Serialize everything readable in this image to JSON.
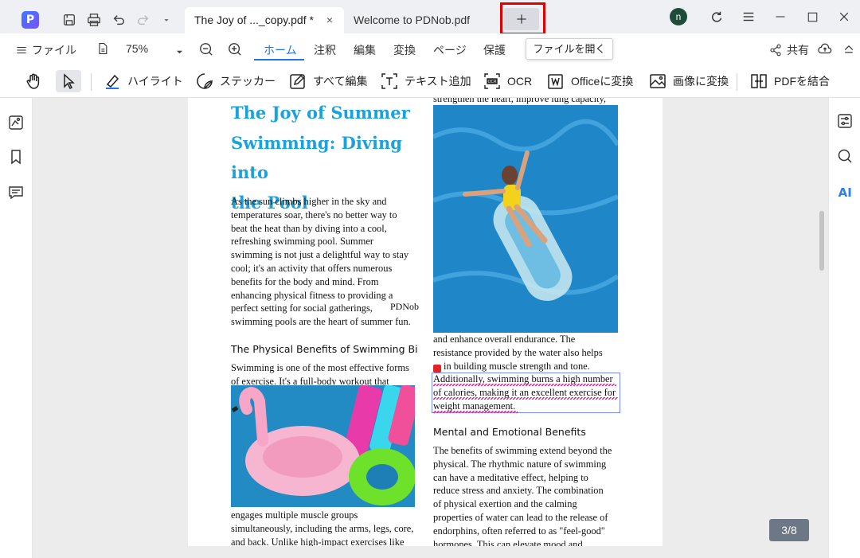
{
  "tabs": [
    {
      "label": "The Joy of ..._copy.pdf *",
      "close": "×",
      "active": true
    },
    {
      "label": "Welcome to PDNob.pdf",
      "active": false
    }
  ],
  "titlebar": {
    "avatar_letter": "n",
    "new_tab_symbol": "+"
  },
  "menu": {
    "file_label": "ファイル",
    "zoom_value": "75%",
    "tabs": [
      "ホーム",
      "注釈",
      "編集",
      "変換",
      "ページ",
      "保護"
    ],
    "share_label": "共有",
    "tooltip": "ファイルを開く"
  },
  "toolbar": {
    "highlight": "ハイライト",
    "sticker": "ステッカー",
    "edit_all": "すべて編集",
    "add_text": "テキスト追加",
    "ocr": "OCR",
    "to_office": "Officeに変換",
    "to_image": "画像に変換",
    "merge_pdf": "PDFを結合"
  },
  "document": {
    "title_lines": [
      "The Joy of Summer",
      "Swimming: Diving into",
      "the Pool"
    ],
    "intro_lines": [
      "As the sun climbs higher in the sky and",
      "temperatures soar, there's no better way to",
      "beat the heat than by diving into a cool,",
      "refreshing swimming pool. Summer",
      "swimming is not just a delightful way to stay",
      "cool; it's an activity that offers numerous",
      "benefits for the body and mind. From",
      "enhancing physical fitness to providing a",
      "perfect setting for social gatherings,",
      "swimming pools are the heart of summer fun."
    ],
    "watermark": "PDNob",
    "heading_physical": "The Physical Benefits of Swimming Bi",
    "physical_lines_top": [
      "Swimming is one of the most effective forms",
      "of exercise. It's a full-body workout that"
    ],
    "physical_lines_bottom": [
      "engages multiple muscle groups",
      "simultaneously, including the arms, legs, core,",
      "and back. Unlike high-impact exercises like"
    ],
    "right_top_line": "strengthen the heart, improve lung capacity,",
    "right_mid_lines": [
      "and enhance overall endurance. The",
      "resistance provided by the water also helps",
      "in building muscle strength and tone."
    ],
    "highlighted_lines": [
      "Additionally, swimming burns a high number",
      "of calories, making it an excellent exercise for",
      "weight management."
    ],
    "heading_mental": "Mental and Emotional Benefits",
    "mental_lines": [
      "The benefits of swimming extend beyond the",
      "physical. The rhythmic nature of swimming",
      "can have a meditative effect, helping to",
      "reduce stress and anxiety. The combination",
      "of physical exertion and the calming",
      "properties of water can lead to the release of",
      "endorphins, often referred to as \"feel-good\"",
      "hormones. This can elevate mood and"
    ]
  },
  "page_indicator": "3/8",
  "colors": {
    "accent": "#1f72f2",
    "title": "#1aa2dc",
    "highlight_frame": "#e00000"
  }
}
